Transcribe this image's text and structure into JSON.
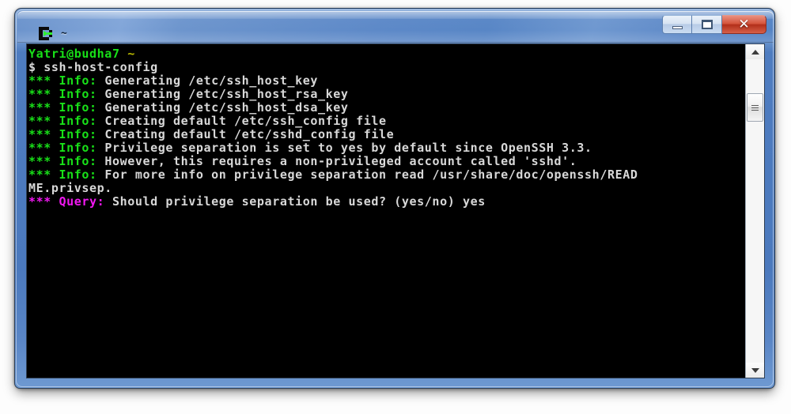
{
  "window": {
    "title": "~",
    "icon": "cygwin-terminal-icon",
    "controls": {
      "minimize_label": "Minimize",
      "maximize_label": "Maximize",
      "close_label": "✕"
    }
  },
  "terminal": {
    "background_color": "#000000",
    "colors": {
      "green": "#18e018",
      "olive": "#b8b800",
      "white": "#d8d8d8",
      "magenta": "#f318f3"
    },
    "lines": [
      {
        "segments": [
          {
            "text": "Yatri@budha7",
            "color": "green"
          },
          {
            "text": " ",
            "color": "white"
          },
          {
            "text": "~",
            "color": "olive"
          }
        ]
      },
      {
        "segments": [
          {
            "text": "$ ssh-host-config",
            "color": "white"
          }
        ]
      },
      {
        "segments": [
          {
            "text": "*** Info:",
            "color": "green"
          },
          {
            "text": " Generating /etc/ssh_host_key",
            "color": "white"
          }
        ]
      },
      {
        "segments": [
          {
            "text": "*** Info:",
            "color": "green"
          },
          {
            "text": " Generating /etc/ssh_host_rsa_key",
            "color": "white"
          }
        ]
      },
      {
        "segments": [
          {
            "text": "*** Info:",
            "color": "green"
          },
          {
            "text": " Generating /etc/ssh_host_dsa_key",
            "color": "white"
          }
        ]
      },
      {
        "segments": [
          {
            "text": "*** Info:",
            "color": "green"
          },
          {
            "text": " Creating default /etc/ssh_config file",
            "color": "white"
          }
        ]
      },
      {
        "segments": [
          {
            "text": "*** Info:",
            "color": "green"
          },
          {
            "text": " Creating default /etc/sshd_config file",
            "color": "white"
          }
        ]
      },
      {
        "segments": [
          {
            "text": "*** Info:",
            "color": "green"
          },
          {
            "text": " Privilege separation is set to yes by default since OpenSSH 3.3.",
            "color": "white"
          }
        ]
      },
      {
        "segments": [
          {
            "text": "*** Info:",
            "color": "green"
          },
          {
            "text": " However, this requires a non-privileged account called 'sshd'.",
            "color": "white"
          }
        ]
      },
      {
        "segments": [
          {
            "text": "*** Info:",
            "color": "green"
          },
          {
            "text": " For more info on privilege separation read /usr/share/doc/openssh/READ",
            "color": "white"
          }
        ]
      },
      {
        "segments": [
          {
            "text": "ME.privsep.",
            "color": "white"
          }
        ]
      },
      {
        "segments": [
          {
            "text": "*** Query:",
            "color": "magenta"
          },
          {
            "text": " Should privilege separation be used? (yes/no) yes",
            "color": "white"
          }
        ]
      }
    ]
  },
  "scrollbar": {
    "up_arrow": "scroll-up-arrow",
    "down_arrow": "scroll-down-arrow",
    "thumb": "scroll-thumb"
  }
}
